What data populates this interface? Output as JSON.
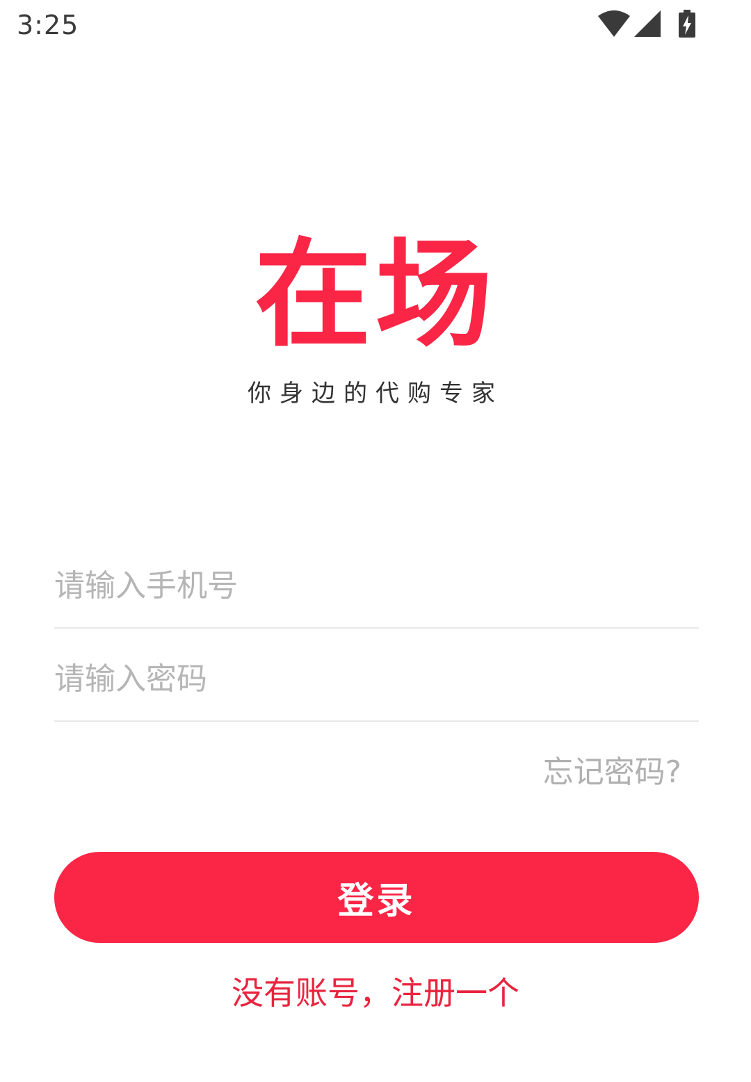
{
  "status_bar": {
    "time": "3:25",
    "icons": [
      "wifi-icon",
      "signal-icon",
      "battery-charging-icon"
    ]
  },
  "logo": {
    "title": "在场",
    "tagline": "你身边的代购专家"
  },
  "form": {
    "phone_placeholder": "请输入手机号",
    "phone_value": "",
    "password_placeholder": "请输入密码",
    "password_value": "",
    "forgot_label": "忘记密码?",
    "login_label": "登录",
    "register_label": "没有账号，注册一个"
  },
  "colors": {
    "accent": "#fb2546",
    "placeholder": "#b5b5b5",
    "divider": "#e8e8e8"
  }
}
